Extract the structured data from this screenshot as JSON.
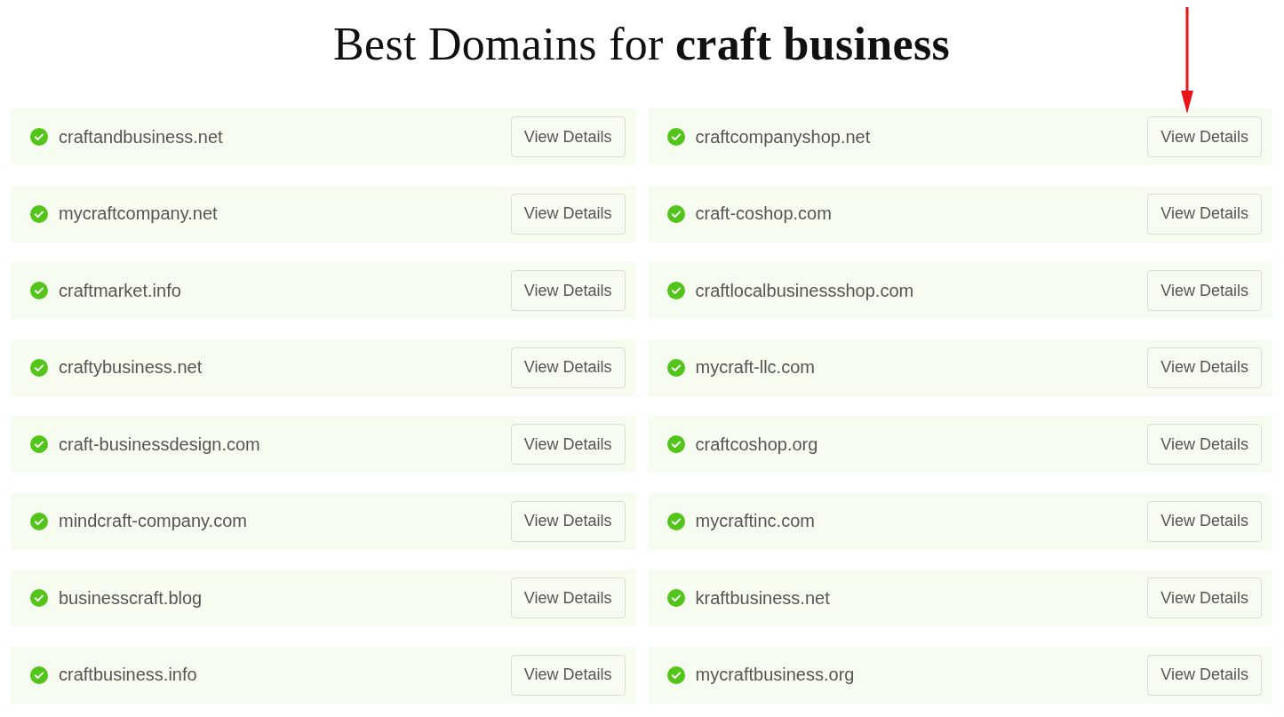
{
  "title": "Best Domains for **craft business**",
  "domains": [
    {
      "name": "craftandbusiness.net",
      "available": true,
      "button": "View Details",
      "arrow": false
    },
    {
      "name": "craftcompanyshop.net",
      "available": true,
      "button": "View Details",
      "arrow": true
    },
    {
      "name": "mycraftcompany.net",
      "available": true,
      "button": "View Details",
      "arrow": false
    },
    {
      "name": "craft-coshop.com",
      "available": true,
      "button": "View Details",
      "arrow": false
    },
    {
      "name": "craftmarket.info",
      "available": true,
      "button": "View Details",
      "arrow": false
    },
    {
      "name": "craftlocalbusinessshop.com",
      "available": true,
      "button": "View Details",
      "arrow": false
    },
    {
      "name": "craftybusiness.net",
      "available": true,
      "button": "View Details",
      "arrow": false
    },
    {
      "name": "mycraft-llc.com",
      "available": true,
      "button": "View Details",
      "arrow": false
    },
    {
      "name": "craft-businessdesign.com",
      "available": true,
      "button": "View Details",
      "arrow": false
    },
    {
      "name": "craftcoshop.org",
      "available": true,
      "button": "View Details",
      "arrow": false
    },
    {
      "name": "mindcraft-company.com",
      "available": true,
      "button": "View Details",
      "arrow": false
    },
    {
      "name": "mycraftinc.com",
      "available": true,
      "button": "View Details",
      "arrow": false
    },
    {
      "name": "businesscraft.blog",
      "available": true,
      "button": "View Details",
      "arrow": false
    },
    {
      "name": "kraftbusiness.net",
      "available": true,
      "button": "View Details",
      "arrow": false
    },
    {
      "name": "craftbusiness.info",
      "available": true,
      "button": "View Details",
      "arrow": false
    },
    {
      "name": "mycraftbusiness.org",
      "available": true,
      "button": "View Details",
      "arrow": false
    }
  ]
}
